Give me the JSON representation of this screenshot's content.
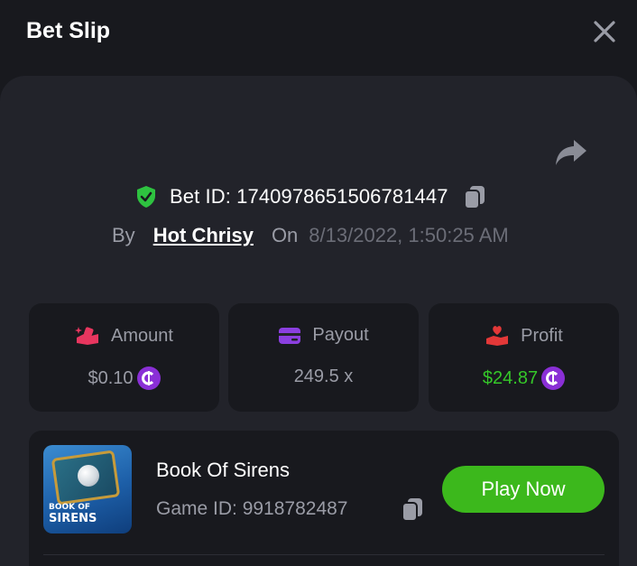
{
  "header": {
    "title": "Bet Slip"
  },
  "bet": {
    "id_text": "Bet ID: 1740978651506781447",
    "by_label": "By",
    "user": "Hot Chrisy",
    "on_label": "On",
    "date": "8/13/2022, 1:50:25 AM"
  },
  "stats": {
    "amount": {
      "label": "Amount",
      "value": "$0.10"
    },
    "payout": {
      "label": "Payout",
      "value": "249.5 x"
    },
    "profit": {
      "label": "Profit",
      "value": "$24.87"
    }
  },
  "game": {
    "name": "Book Of Sirens",
    "id_text": "Game ID: 9918782487",
    "thumb_line1": "BOOK OF",
    "thumb_line2": "SIRENS",
    "play_label": "Play Now"
  },
  "colors": {
    "background": "#18191e",
    "panel": "#22232a",
    "accent_green": "#3cb81c",
    "profit_green": "#35c729",
    "coin_purple": "#8a2fd6",
    "shield_green": "#2ec240",
    "amount_icon": "#e8365f",
    "payout_icon": "#8b3fe0",
    "profit_icon": "#e33838"
  },
  "icons": {
    "close": "close-icon",
    "share": "share-icon",
    "shield": "shield-check-icon",
    "copy": "copy-icon",
    "amount": "hand-coins-icon",
    "payout": "wallet-card-icon",
    "profit": "hand-heart-icon",
    "coin": "coin-icon"
  }
}
